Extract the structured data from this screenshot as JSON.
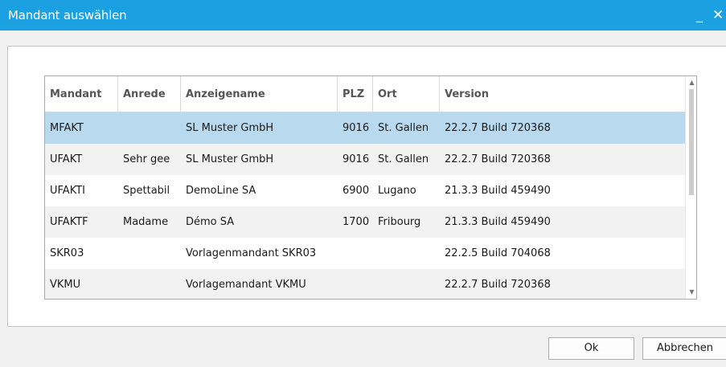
{
  "window": {
    "title": "Mandant auswählen",
    "minimize_glyph": "_",
    "close_glyph": "✕"
  },
  "grid": {
    "columns": [
      "Mandant",
      "Anrede",
      "Anzeigename",
      "PLZ",
      "Ort",
      "Version"
    ],
    "rows": [
      {
        "mandant": "MFAKT",
        "anrede": "",
        "anzeigename": "SL Muster GmbH",
        "plz": "9016",
        "ort": "St. Gallen",
        "version": "22.2.7 Build 720368",
        "selected": true
      },
      {
        "mandant": "UFAKT",
        "anrede": "Sehr gee",
        "anzeigename": "SL Muster GmbH",
        "plz": "9016",
        "ort": "St. Gallen",
        "version": "22.2.7 Build 720368",
        "selected": false
      },
      {
        "mandant": "UFAKTI",
        "anrede": "Spettabil",
        "anzeigename": "DemoLine SA",
        "plz": "6900",
        "ort": "Lugano",
        "version": "21.3.3 Build 459490",
        "selected": false
      },
      {
        "mandant": "UFAKTF",
        "anrede": "Madame",
        "anzeigename": "Démo SA",
        "plz": "1700",
        "ort": "Fribourg",
        "version": "21.3.3 Build 459490",
        "selected": false
      },
      {
        "mandant": "SKR03",
        "anrede": "",
        "anzeigename": "Vorlagenmandant SKR03",
        "plz": "",
        "ort": "",
        "version": "22.2.5 Build 704068",
        "selected": false
      },
      {
        "mandant": "VKMU",
        "anrede": "",
        "anzeigename": "Vorlagemandant VKMU",
        "plz": "",
        "ort": "",
        "version": "22.2.7 Build 720368",
        "selected": false
      }
    ],
    "scroll_up_glyph": "▲",
    "scroll_down_glyph": "▼"
  },
  "buttons": {
    "ok_label": "Ok",
    "cancel_label": "Abbrechen"
  },
  "colors": {
    "titlebar": "#1ba1e2",
    "selection": "#b8d9ee",
    "alt_row": "#f2f2f2"
  }
}
